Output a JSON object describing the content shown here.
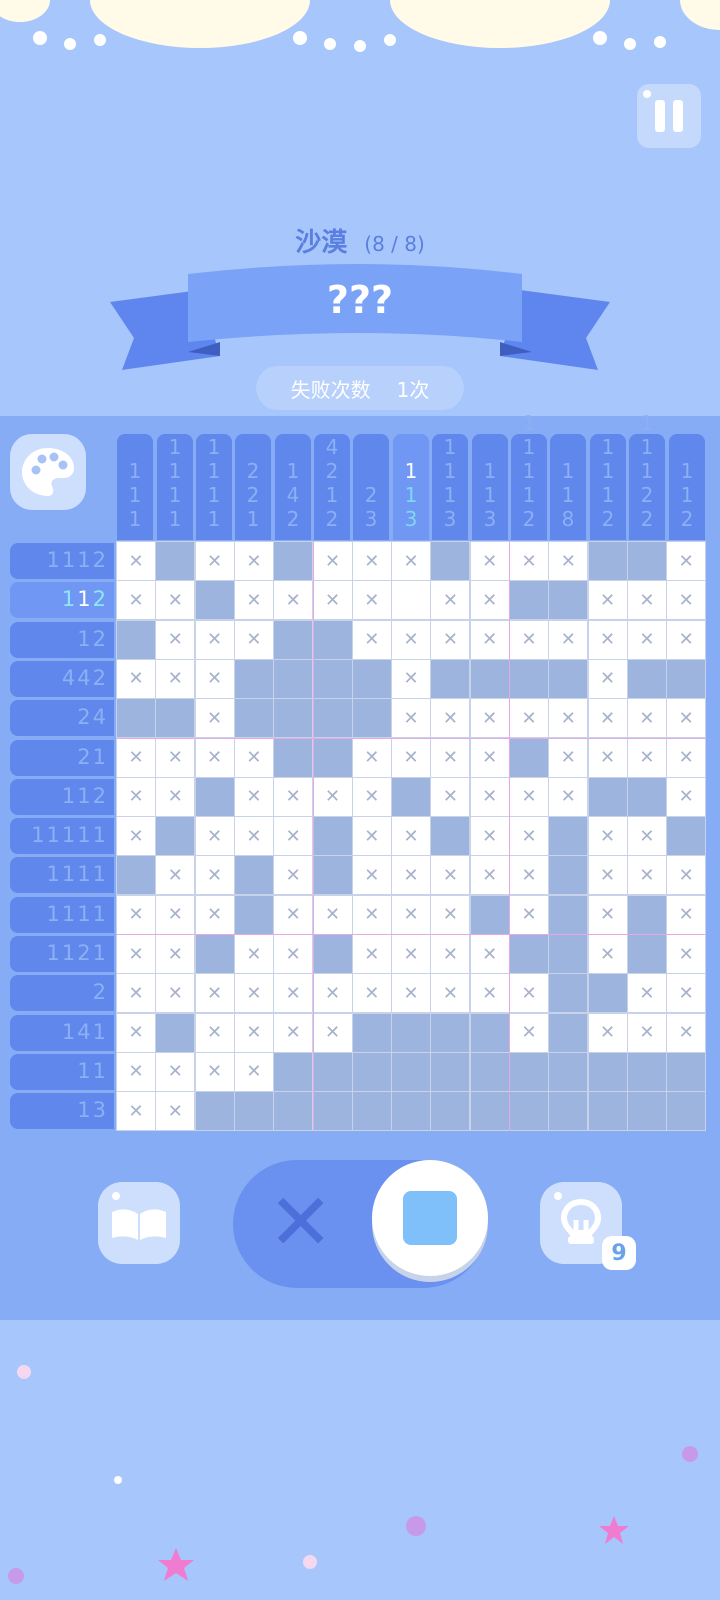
{
  "level": {
    "name": "沙漠",
    "progress": "(8 / 8)",
    "ribbon_title": "???"
  },
  "fail": {
    "label": "失败次数",
    "count": "1次"
  },
  "hint": {
    "count": "9"
  },
  "col_clues": [
    [
      "1",
      "1",
      "1"
    ],
    [
      "1",
      "1",
      "1",
      "1"
    ],
    [
      "1",
      "1",
      "1",
      "1"
    ],
    [
      "2",
      "2",
      "1"
    ],
    [
      "1",
      "4",
      "2"
    ],
    [
      "4",
      "2",
      "1",
      "2"
    ],
    [
      "2",
      "3"
    ],
    [
      "1",
      "1",
      "3"
    ],
    [
      "1",
      "1",
      "1",
      "3"
    ],
    [
      "1",
      "1",
      "3"
    ],
    [
      "1",
      "1",
      "1",
      "1",
      "2"
    ],
    [
      "1",
      "1",
      "8"
    ],
    [
      "1",
      "1",
      "1",
      "2"
    ],
    [
      "1",
      "1",
      "1",
      "2",
      "2"
    ],
    [
      "1",
      "1",
      "2"
    ]
  ],
  "row_clues": [
    "1112",
    "112",
    "12",
    "442",
    "24",
    "21",
    "112",
    "11111",
    "1111",
    "1111",
    "1121",
    "2",
    "141",
    "11",
    "13"
  ],
  "grid": [
    "XFXXFXXXFXXXFFX",
    "XXFXXXXEXXFFXXX",
    "FXXXFFXXXXXXXXX",
    "XXXFFFFXFFFFXFF",
    "FFXFFFFXXXXXXXX",
    "XXXXFFXXXXFXXXX",
    "XXFXXXXFXXXXFFX",
    "XFXXXFXXFXXFXXF",
    "FXXFXFXXXXXFXXX",
    "XXXFXXXXXFXFXFX",
    "XXFXXFXXXXFFXFX",
    "XXXXXXXXXXXFFXX",
    "XFXXXXFFFFXFXXX",
    "XXXXFFFFFFFFFFF",
    "XXFFFFFFFFFFFFF"
  ],
  "icons": {
    "pause": "pause-icon",
    "palette": "palette-icon",
    "book": "book-icon",
    "hint": "lightbulb-icon",
    "cross": "cross-icon",
    "fill": "fill-square-icon"
  }
}
